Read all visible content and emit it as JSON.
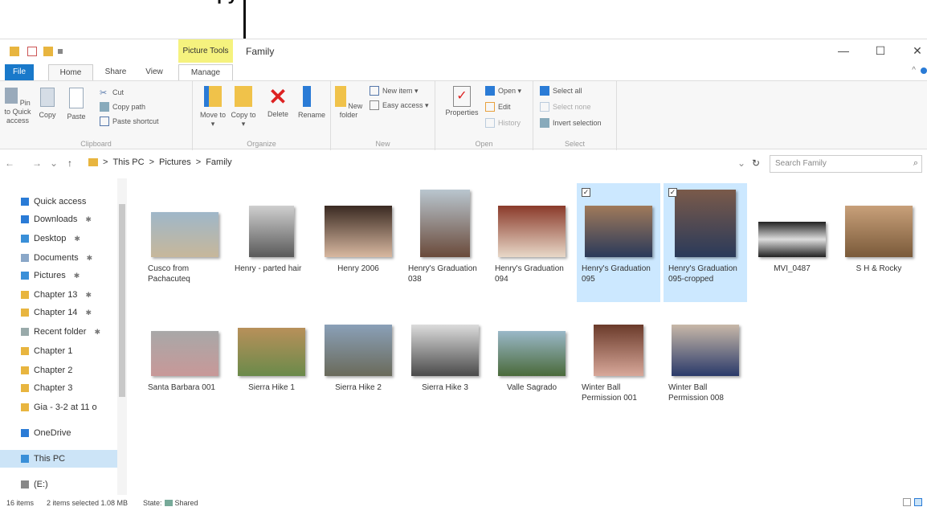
{
  "callout": {
    "fragment": "py"
  },
  "titlebar": {
    "context_tab": "Picture Tools",
    "title": "Family",
    "controls": {
      "minimize": "—",
      "maximize": "☐",
      "close": "✕"
    }
  },
  "tabs": {
    "file": "File",
    "home": "Home",
    "share": "Share",
    "view": "View",
    "manage": "Manage"
  },
  "ribbon": {
    "clipboard": {
      "pin_label": "Pin to Quick access",
      "copy_label": "Copy",
      "paste_label": "Paste",
      "cut_label": "Cut",
      "copy_path_label": "Copy path",
      "paste_shortcut_label": "Paste shortcut",
      "group_label": "Clipboard"
    },
    "organize": {
      "move_to_label": "Move to ▾",
      "copy_to_label": "Copy to ▾",
      "delete_label": "Delete",
      "rename_label": "Rename",
      "group_label": "Organize"
    },
    "new": {
      "new_folder_label": "New folder",
      "new_item_label": "New item ▾",
      "easy_access_label": "Easy access ▾",
      "group_label": "New"
    },
    "open": {
      "properties_label": "Properties",
      "open_label": "Open ▾",
      "edit_label": "Edit",
      "history_label": "History",
      "group_label": "Open"
    },
    "select": {
      "select_all_label": "Select all",
      "select_none_label": "Select none",
      "invert_selection_label": "Invert selection",
      "group_label": "Select"
    }
  },
  "address": {
    "back": "←",
    "forward": "→",
    "recent": "⌄",
    "up": "↑",
    "path": [
      "This PC",
      "Pictures",
      "Family"
    ],
    "separator": ">",
    "dropdown": "⌄",
    "refresh": "↻",
    "search_placeholder": "Search Family",
    "search_icon": "⌕"
  },
  "nav": {
    "pin_glyph": "✱",
    "items": [
      {
        "label": "Quick access",
        "icon": "star-icon",
        "color": "#2a7bd6"
      },
      {
        "label": "Downloads",
        "icon": "downloads-folder-icon",
        "color": "#2a7bd6"
      },
      {
        "label": "Desktop",
        "icon": "desktop-folder-icon",
        "color": "#3a8fd8"
      },
      {
        "label": "Documents",
        "icon": "documents-folder-icon",
        "color": "#8aa7c8"
      },
      {
        "label": "Pictures",
        "icon": "pictures-folder-icon",
        "color": "#3a8fd8"
      },
      {
        "label": "Chapter 13",
        "icon": "folder-icon",
        "color": "#e8b53f"
      },
      {
        "label": "Chapter 14",
        "icon": "folder-icon",
        "color": "#e8b53f"
      },
      {
        "label": "Recent folder",
        "icon": "recent-folder-icon",
        "color": "#9aa"
      },
      {
        "label": "Chapter 1",
        "icon": "folder-icon",
        "color": "#e8b53f"
      },
      {
        "label": "Chapter 2",
        "icon": "folder-icon",
        "color": "#e8b53f"
      },
      {
        "label": "Chapter 3",
        "icon": "folder-icon",
        "color": "#e8b53f"
      },
      {
        "label": "Gia - 3-2 at 11 o",
        "icon": "folder-icon",
        "color": "#e8b53f"
      },
      {
        "label": "OneDrive",
        "icon": "onedrive-icon",
        "color": "#2a7bd6"
      },
      {
        "label": "This PC",
        "icon": "this-pc-icon",
        "color": "#3a8fd8"
      },
      {
        "label": "(E:)",
        "icon": "drive-icon",
        "color": "#888"
      }
    ]
  },
  "files": [
    {
      "name": "Cusco from Pachacuteq",
      "selected": false
    },
    {
      "name": "Henry - parted hair",
      "selected": false
    },
    {
      "name": "Henry 2006",
      "selected": false
    },
    {
      "name": "Henry's Graduation 038",
      "selected": false
    },
    {
      "name": "Henry's Graduation 094",
      "selected": false
    },
    {
      "name": "Henry's Graduation 095",
      "selected": true
    },
    {
      "name": "Henry's Graduation 095-cropped",
      "selected": true
    },
    {
      "name": "MVI_0487",
      "selected": false
    },
    {
      "name": "S H & Rocky",
      "selected": false
    },
    {
      "name": "Santa Barbara 001",
      "selected": false
    },
    {
      "name": "Sierra Hike 1",
      "selected": false
    },
    {
      "name": "Sierra Hike 2",
      "selected": false
    },
    {
      "name": "Sierra Hike 3",
      "selected": false
    },
    {
      "name": "Valle Sagrado",
      "selected": false
    },
    {
      "name": "Winter Ball Permission 001",
      "selected": false
    },
    {
      "name": "Winter Ball Permission 008",
      "selected": false
    }
  ],
  "checkmark": "✓",
  "status": {
    "items": "16 items",
    "selected": "2 items selected  1.08 MB",
    "state_label": "State:",
    "state_value": "Shared"
  },
  "colors": {
    "accent": "#1979ca",
    "selection": "#cce8ff",
    "context_tab": "#f5f27e",
    "folder": "#e8b53f"
  }
}
